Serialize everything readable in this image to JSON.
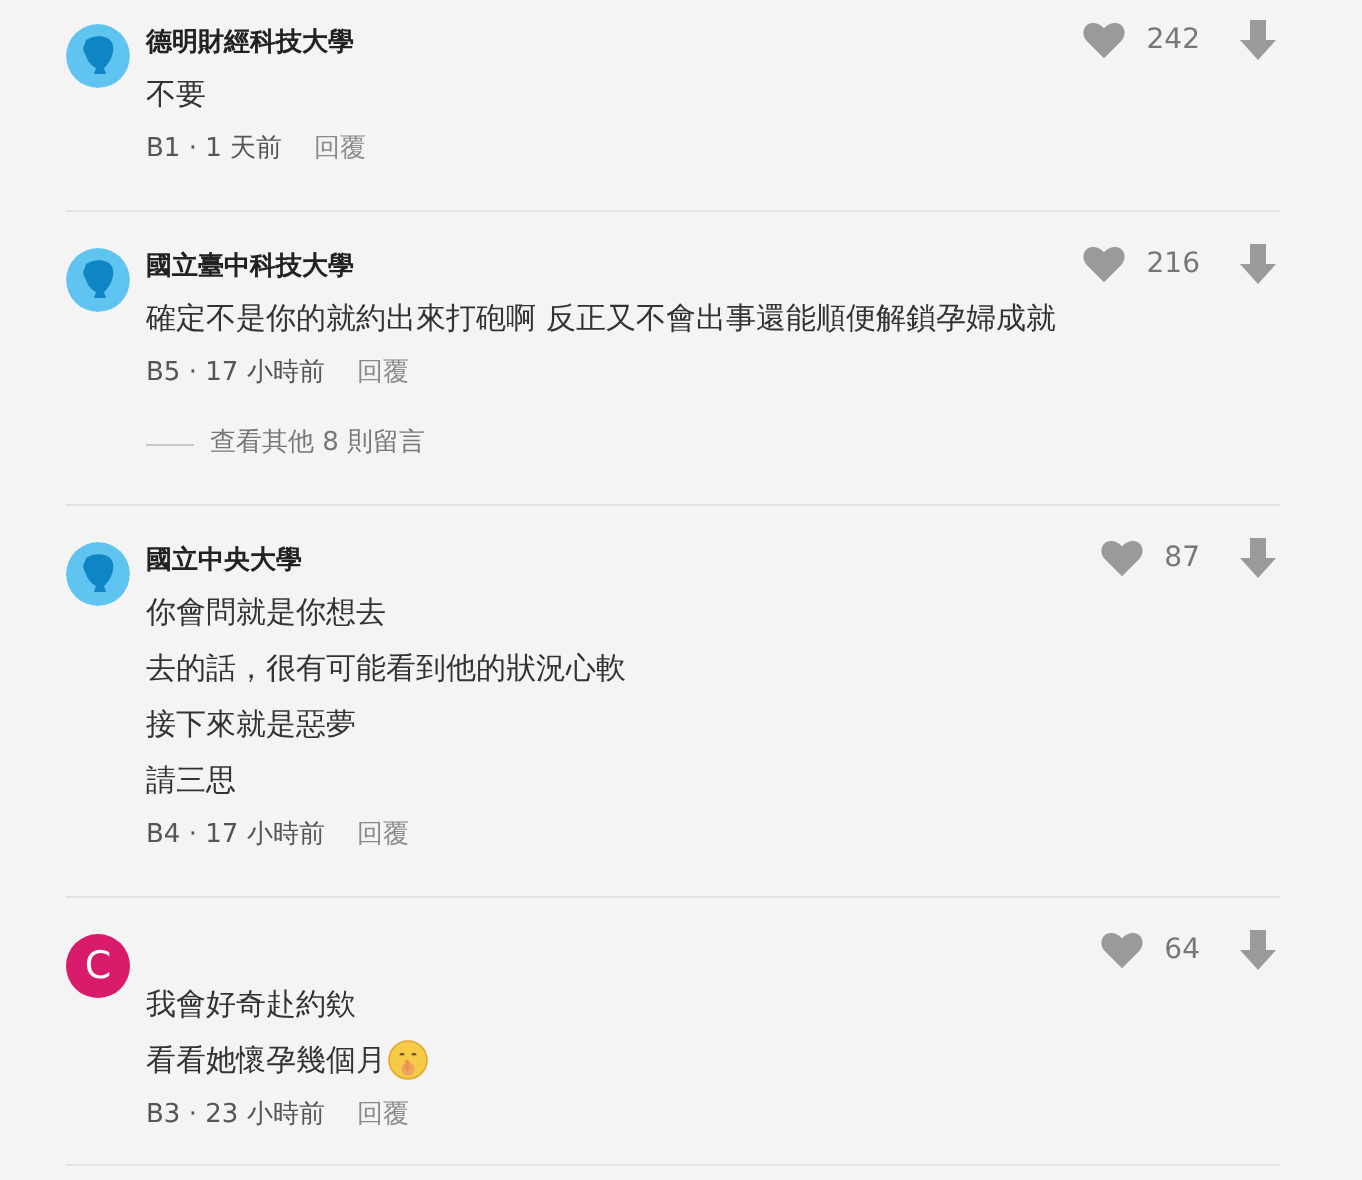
{
  "comments": [
    {
      "avatar": {
        "kind": "school"
      },
      "author": "德明財經科技大學",
      "likes": "242",
      "lines": [
        {
          "text": "不要"
        }
      ],
      "meta": "B1 · 1 天前",
      "reply": "回覆"
    },
    {
      "avatar": {
        "kind": "school"
      },
      "author": "國立臺中科技大學",
      "likes": "216",
      "lines": [
        {
          "text": "確定不是你的就約出來打砲啊 反正又不會出事還能順便解鎖孕婦成就"
        }
      ],
      "meta": "B5 · 17 小時前",
      "reply": "回覆",
      "more_replies": "查看其他 8 則留言"
    },
    {
      "avatar": {
        "kind": "school"
      },
      "author": "國立中央大學",
      "likes": "87",
      "lines": [
        {
          "text": "你會問就是你想去"
        },
        {
          "text": "去的話，很有可能看到他的狀況心軟"
        },
        {
          "text": "接下來就是惡夢"
        },
        {
          "text": "請三思"
        }
      ],
      "meta": "B4 · 17 小時前",
      "reply": "回覆"
    },
    {
      "avatar": {
        "kind": "letter",
        "letter": "C",
        "color": "#d81b6a"
      },
      "likes": "64",
      "lines": [
        {
          "text": "我會好奇赴約欸"
        },
        {
          "text": "看看她懷孕幾個月",
          "trailing_icon": true
        }
      ],
      "meta": "B3 · 23 小時前",
      "reply": "回覆"
    }
  ]
}
